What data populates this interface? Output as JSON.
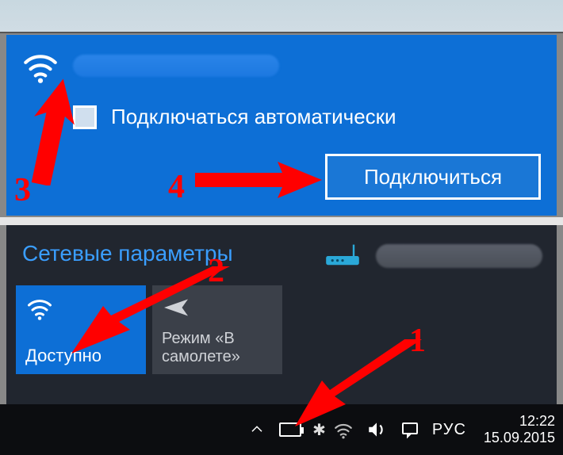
{
  "flyout": {
    "auto_connect_label": "Подключаться автоматически",
    "connect_button": "Подключиться"
  },
  "panel": {
    "title": "Сетевые параметры",
    "wifi_tile_label": "Доступно",
    "airplane_tile_label": "Режим «В самолете»"
  },
  "taskbar": {
    "lang": "РУС",
    "time": "12:22",
    "date": "15.09.2015"
  },
  "annotations": {
    "n1": "1",
    "n2": "2",
    "n3": "3",
    "n4": "4"
  }
}
